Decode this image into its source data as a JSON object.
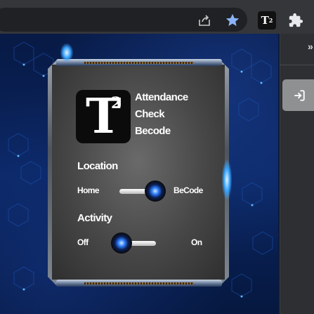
{
  "toolbar": {
    "icons": [
      "share-icon",
      "star-icon",
      "t2-extension-icon",
      "puzzle-icon"
    ],
    "pinned_extension": {
      "letter": "T",
      "superscript": "2"
    },
    "accent": "#8ab4f8"
  },
  "page": {
    "chevron": "»"
  },
  "popup": {
    "logo": {
      "letter": "T",
      "superscript": "2"
    },
    "title_lines": [
      "Attendance",
      "Check",
      "Becode"
    ],
    "location": {
      "heading": "Location",
      "left_label": "Home",
      "right_label": "BeCode",
      "selected": "BeCode"
    },
    "activity": {
      "heading": "Activity",
      "left_label": "Off",
      "right_label": "On",
      "selected": "Off"
    },
    "colors": {
      "glow": "#39a4ff",
      "background": "#0a2560"
    }
  }
}
